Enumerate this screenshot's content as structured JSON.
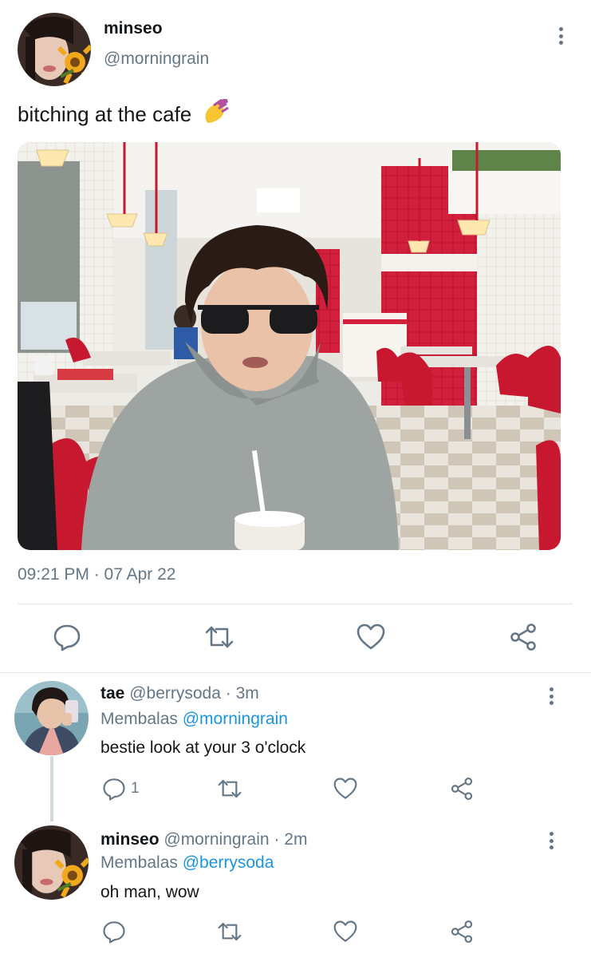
{
  "tweet": {
    "display_name": "minseo",
    "handle": "@morningrain",
    "text": "bitching at the cafe",
    "emoji": "nail-polish-emoji",
    "media": "photo-person-in-diner",
    "timestamp": "09:21 PM · 07 Apr 22",
    "actions": {
      "reply": "reply-icon",
      "retweet": "retweet-icon",
      "like": "heart-icon",
      "share": "share-icon"
    }
  },
  "replies": [
    {
      "display_name": "tae",
      "handle": "@berrysoda",
      "separator": "·",
      "time": "3m",
      "replying_prefix": "Membalas",
      "replying_to": "@morningrain",
      "text": "bestie look at your 3 o'clock",
      "reply_count": "1"
    },
    {
      "display_name": "minseo",
      "handle": "@morningrain",
      "separator": "·",
      "time": "2m",
      "replying_prefix": "Membalas",
      "replying_to": "@berrysoda",
      "text": "oh man, wow",
      "reply_count": ""
    }
  ],
  "colors": {
    "text_primary": "#14171a",
    "text_secondary": "#657786",
    "link": "#1b95e0",
    "divider": "#e1e8ed"
  }
}
